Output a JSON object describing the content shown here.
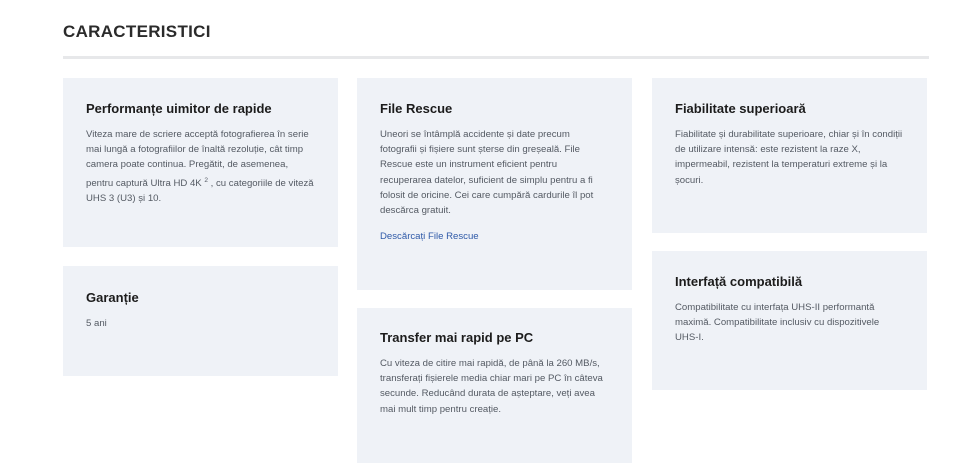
{
  "section": {
    "title": "CARACTERISTICI"
  },
  "cards": {
    "performance": {
      "title": "Performanțe uimitor de rapide",
      "text_before_sup": "Viteza mare de scriere acceptă fotografierea în serie mai lungă a fotografiilor de înaltă rezoluție, cât timp camera poate continua. Pregătit, de asemenea, pentru captură Ultra HD 4K ",
      "sup": "2",
      "text_after_sup": " , cu categoriile de viteză UHS 3 (U3) și 10."
    },
    "warranty": {
      "title": "Garanție",
      "text": "5 ani"
    },
    "file_rescue": {
      "title": "File Rescue",
      "text": "Uneori se întâmplă accidente și date precum fotografii și fișiere sunt șterse din greșeală. File Rescue este un instrument eficient pentru recuperarea datelor, suficient de simplu pentru a fi folosit de oricine. Cei care cumpără cardurile îl pot descărca gratuit.",
      "link": "Descărcați File Rescue"
    },
    "transfer": {
      "title": "Transfer mai rapid pe PC",
      "text": "Cu viteza de citire mai rapidă, de până la 260 MB/s, transferați fișierele media chiar mari pe PC în câteva secunde. Reducând durata de așteptare, veți avea mai mult timp pentru creație."
    },
    "reliability": {
      "title": "Fiabilitate superioară",
      "text": "Fiabilitate și durabilitate superioare, chiar și în condiții de utilizare intensă: este rezistent la raze X, impermeabil, rezistent la temperaturi extreme și la șocuri."
    },
    "interface": {
      "title": "Interfață compatibilă",
      "text": "Compatibilitate cu interfața UHS-II performantă maximă. Compatibilitate inclusiv cu dispozitivele UHS-I."
    }
  }
}
